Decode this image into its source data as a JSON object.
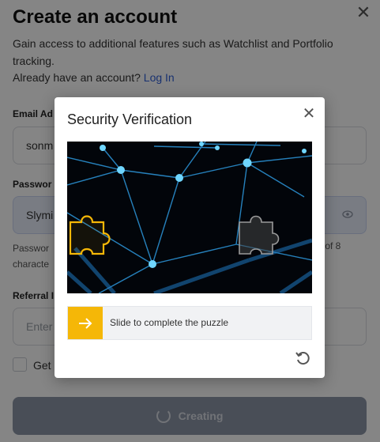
{
  "page": {
    "title": "Create an account",
    "subtitle": "Gain access to additional features such as Watchlist and Portfolio tracking.",
    "login_prompt": "Already have an account?",
    "login_link": "Log In",
    "email_label": "Email Ad",
    "email_value": "sonm",
    "password_label": "Passwor",
    "password_value": "Slymi",
    "password_hint_left": "Passwor",
    "password_hint_left2": "characte",
    "password_hint_right": "th of 8",
    "referral_label": "Referral I",
    "referral_placeholder": "Enter",
    "checkbox_label": "Get",
    "submit_label": "Creating"
  },
  "modal": {
    "title": "Security Verification",
    "slider_text": "Slide to complete the puzzle"
  },
  "colors": {
    "accent_yellow": "#f5b707",
    "link_blue": "#2f5fd6",
    "network_cyan": "#2fa6e8"
  },
  "icons": {
    "close": "close-icon",
    "eye": "eye-icon",
    "arrow": "arrow-right-icon",
    "refresh": "refresh-icon"
  }
}
